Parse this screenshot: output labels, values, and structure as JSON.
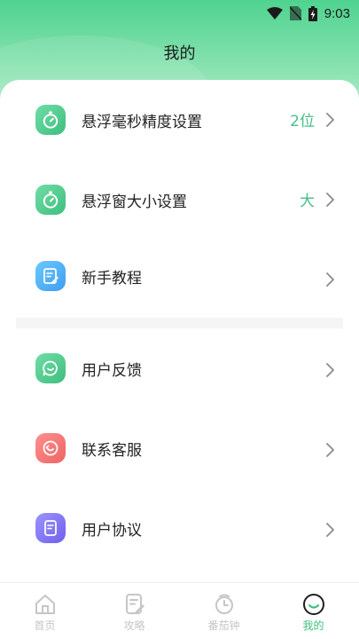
{
  "status_bar": {
    "time": "9:03",
    "icons": [
      "wifi-icon",
      "no-sim-icon",
      "battery-charging-icon"
    ]
  },
  "page": {
    "title": "我的"
  },
  "menu": [
    {
      "label": "悬浮毫秒精度设置",
      "value": "2位",
      "icon": "stopwatch-icon",
      "color": "#4ccc8c"
    },
    {
      "label": "悬浮窗大小设置",
      "value": "大",
      "icon": "stopwatch-icon",
      "color": "#4ccc8c"
    },
    {
      "label": "新手教程",
      "value": "",
      "icon": "tutorial-doc-icon",
      "color": "#4aa8f5"
    },
    {
      "label": "用户反馈",
      "value": "",
      "icon": "feedback-chat-icon",
      "color": "#4ccc8c"
    },
    {
      "label": "联系客服",
      "value": "",
      "icon": "customer-service-icon",
      "color": "#f07070"
    },
    {
      "label": "用户协议",
      "value": "",
      "icon": "agreement-doc-icon",
      "color": "#7d72f2"
    }
  ],
  "tabbar": {
    "tabs": [
      {
        "label": "首页",
        "icon": "home-icon",
        "active": false
      },
      {
        "label": "攻略",
        "icon": "guide-doc-icon",
        "active": false
      },
      {
        "label": "番茄钟",
        "icon": "pomodoro-clock-icon",
        "active": false
      },
      {
        "label": "我的",
        "icon": "smile-profile-icon",
        "active": true
      }
    ],
    "active_color": "#3cbf7b",
    "inactive_color": "#c6c6c6"
  }
}
